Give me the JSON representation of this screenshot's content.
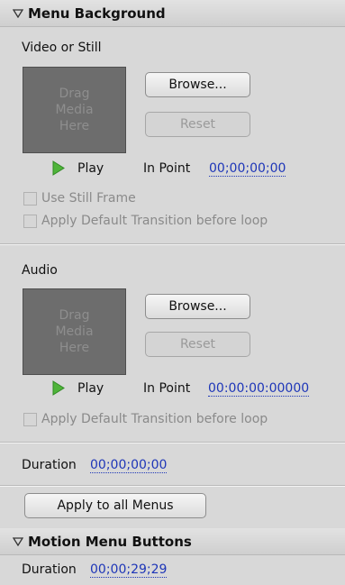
{
  "menu_background": {
    "header": "Menu Background",
    "video": {
      "label": "Video or Still",
      "drop_text": "Drag Media Here",
      "browse_label": "Browse...",
      "reset_label": "Reset",
      "play_label": "Play",
      "in_point_label": "In Point",
      "in_point_value": "00;00;00;00",
      "use_still_frame_label": "Use Still Frame",
      "apply_default_transition_label": "Apply Default Transition before loop"
    },
    "audio": {
      "label": "Audio",
      "drop_text": "Drag Media Here",
      "browse_label": "Browse...",
      "reset_label": "Reset",
      "play_label": "Play",
      "in_point_label": "In Point",
      "in_point_value": "00:00:00:00000",
      "apply_default_transition_label": "Apply Default Transition before loop"
    },
    "duration_label": "Duration",
    "duration_value": "00;00;00;00",
    "apply_all_label": "Apply to all Menus"
  },
  "motion_menu_buttons": {
    "header": "Motion Menu Buttons",
    "duration_label": "Duration",
    "duration_value": "00;00;29;29"
  },
  "colors": {
    "panel_bg": "#d8d8d8",
    "timecode_link": "#1e36b8",
    "play_green": "#4fb43a",
    "dropbox_bg": "#6d6d6d"
  }
}
